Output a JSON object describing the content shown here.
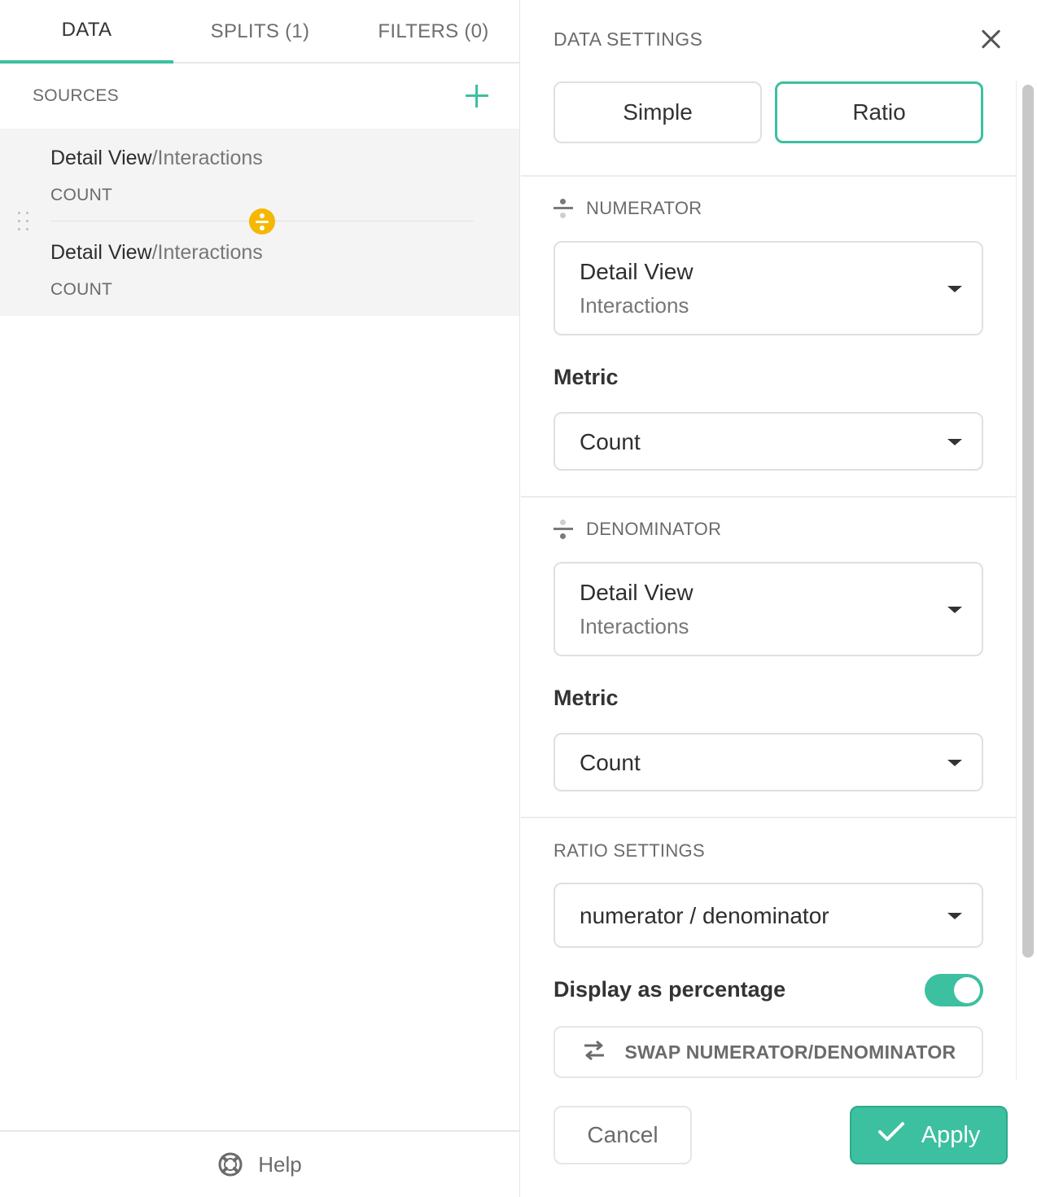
{
  "tabs": [
    {
      "label": "DATA",
      "active": true
    },
    {
      "label": "SPLITS (1)",
      "active": false
    },
    {
      "label": "FILTERS (0)",
      "active": false
    }
  ],
  "sources": {
    "label": "SOURCES",
    "add_icon": "plus-icon",
    "items": [
      {
        "title": "Detail View",
        "subtitle": "/Interactions",
        "metric": "COUNT"
      },
      {
        "title": "Detail View",
        "subtitle": "/Interactions",
        "metric": "COUNT"
      }
    ],
    "operator_icon": "divide-icon"
  },
  "help": {
    "label": "Help",
    "icon": "lifebuoy-icon"
  },
  "data_settings": {
    "title": "DATA SETTINGS",
    "close_icon": "close-icon",
    "modes": [
      {
        "label": "Simple",
        "selected": false
      },
      {
        "label": "Ratio",
        "selected": true
      }
    ],
    "numerator": {
      "label": "NUMERATOR",
      "source_main": "Detail View",
      "source_sub": "Interactions",
      "metric_label": "Metric",
      "metric_value": "Count"
    },
    "denominator": {
      "label": "DENOMINATOR",
      "source_main": "Detail View",
      "source_sub": "Interactions",
      "metric_label": "Metric",
      "metric_value": "Count"
    },
    "ratio_settings": {
      "label": "RATIO SETTINGS",
      "formula": "numerator / denominator",
      "display_percentage_label": "Display as percentage",
      "display_percentage": true,
      "swap_label": "SWAP NUMERATOR/DENOMINATOR",
      "swap_icon": "swap-arrows-icon"
    },
    "cancel_label": "Cancel",
    "apply_label": "Apply",
    "apply_icon": "check-icon"
  },
  "colors": {
    "accent": "#3cc0a0",
    "divide_badge": "#f5b700"
  }
}
